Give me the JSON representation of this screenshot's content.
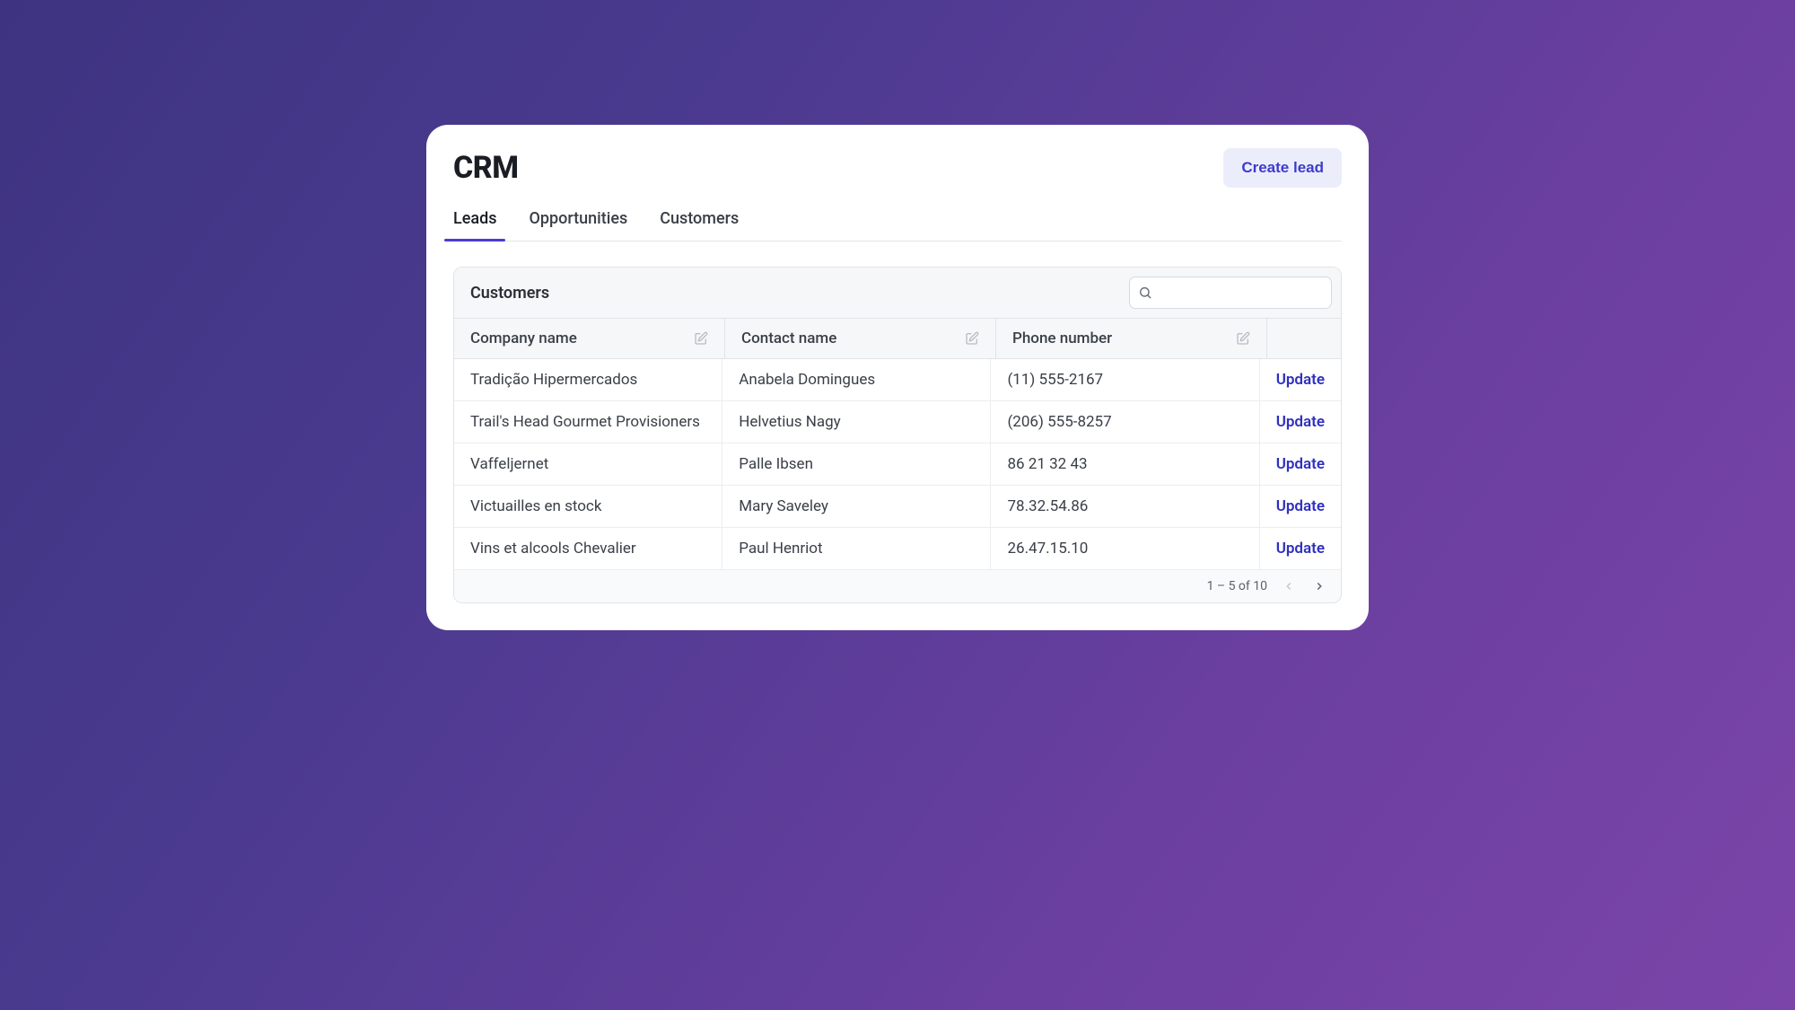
{
  "header": {
    "title": "CRM",
    "create_label": "Create lead"
  },
  "tabs": [
    {
      "label": "Leads",
      "active": true
    },
    {
      "label": "Opportunities",
      "active": false
    },
    {
      "label": "Customers",
      "active": false
    }
  ],
  "table": {
    "title": "Customers",
    "search_placeholder": "",
    "columns": [
      {
        "label": "Company name"
      },
      {
        "label": "Contact name"
      },
      {
        "label": "Phone number"
      }
    ],
    "action_label": "Update",
    "rows": [
      {
        "company": "Tradição Hipermercados",
        "contact": "Anabela Domingues",
        "phone": "(11) 555-2167"
      },
      {
        "company": "Trail's Head Gourmet Provisioners",
        "contact": "Helvetius Nagy",
        "phone": "(206) 555-8257"
      },
      {
        "company": "Vaffeljernet",
        "contact": "Palle Ibsen",
        "phone": "86 21 32 43"
      },
      {
        "company": "Victuailles en stock",
        "contact": "Mary Saveley",
        "phone": "78.32.54.86"
      },
      {
        "company": "Vins et alcools Chevalier",
        "contact": "Paul Henriot",
        "phone": "26.47.15.10"
      }
    ],
    "pagination": {
      "range_text": "1 – 5 of 10",
      "prev_disabled": true,
      "next_disabled": false
    }
  }
}
